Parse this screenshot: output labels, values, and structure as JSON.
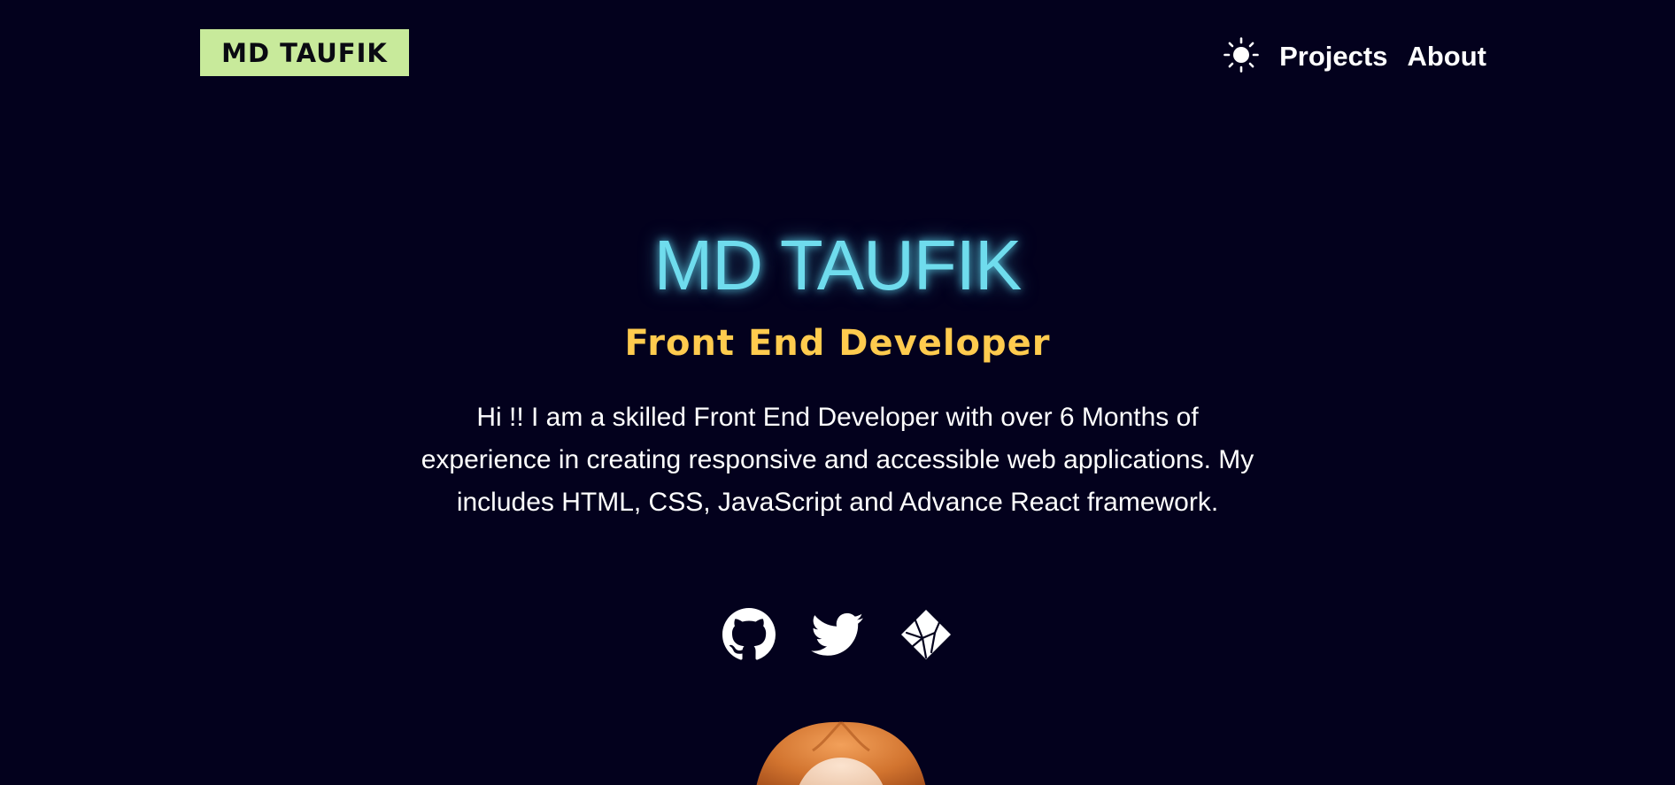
{
  "header": {
    "logo_text": "MD TAUFIK",
    "theme_toggle_icon": "sun-icon",
    "nav": [
      {
        "label": "Projects"
      },
      {
        "label": "About"
      }
    ]
  },
  "hero": {
    "name": "MD TAUFIK",
    "role": "Front End Developer",
    "description": "Hi !! I am a skilled Front End Developer with over 6 Months of experience in creating responsive and accessible web applications. My includes HTML, CSS, JavaScript and Advance React framework."
  },
  "socials": [
    {
      "icon": "github-icon"
    },
    {
      "icon": "twitter-icon"
    },
    {
      "icon": "netlify-icon"
    }
  ],
  "colors": {
    "background": "#03011d",
    "logo_bg": "#c8ea9b",
    "name_accent": "#6fdced",
    "role_accent": "#ffcb4e",
    "text": "#ffffff"
  }
}
